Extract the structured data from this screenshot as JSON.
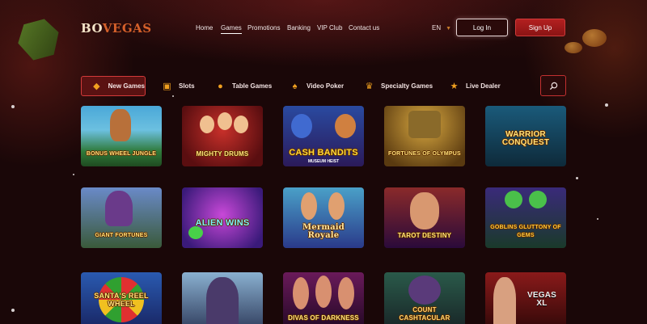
{
  "brand": {
    "logo_part1": "BO",
    "logo_part2": "VEGAS"
  },
  "nav": {
    "items": [
      {
        "label": "Home",
        "active": false
      },
      {
        "label": "Games",
        "active": true
      },
      {
        "label": "Promotions",
        "active": false
      },
      {
        "label": "Banking",
        "active": false
      },
      {
        "label": "VIP Club",
        "active": false
      },
      {
        "label": "Contact us",
        "active": false
      }
    ],
    "language": "EN",
    "login_label": "Log In",
    "signup_label": "Sign Up"
  },
  "categories": [
    {
      "label": "New Games",
      "icon": "diamond-icon",
      "active": true
    },
    {
      "label": "Slots",
      "icon": "slot-machine-icon",
      "active": false
    },
    {
      "label": "Table Games",
      "icon": "chip-icon",
      "active": false
    },
    {
      "label": "Video Poker",
      "icon": "spade-icon",
      "active": false
    },
    {
      "label": "Specialty Games",
      "icon": "crown-icon",
      "active": false
    },
    {
      "label": "Live Dealer",
      "icon": "star-icon",
      "active": false
    }
  ],
  "games": [
    {
      "title": "BONUS WHEEL JUNGLE",
      "subtitle": ""
    },
    {
      "title": "MIGHTY DRUMS",
      "subtitle": ""
    },
    {
      "title": "CASH BANDITS",
      "subtitle": "MUSEUM HEIST"
    },
    {
      "title": "FORTUNES OF OLYMPUS",
      "subtitle": ""
    },
    {
      "title": "WARRIOR CONQUEST",
      "subtitle": ""
    },
    {
      "title": "GIANT FORTUNES",
      "subtitle": ""
    },
    {
      "title": "ALIEN WINS",
      "subtitle": ""
    },
    {
      "title": "Mermaid Royale",
      "subtitle": ""
    },
    {
      "title": "TAROT DESTINY",
      "subtitle": ""
    },
    {
      "title": "GOBLINS GLUTTONY OF GEMS",
      "subtitle": ""
    },
    {
      "title": "SANTA'S REEL WHEEL",
      "subtitle": ""
    },
    {
      "title": "",
      "subtitle": ""
    },
    {
      "title": "DIVAS OF DARKNESS",
      "subtitle": ""
    },
    {
      "title": "COUNT CASHTACULAR",
      "subtitle": ""
    },
    {
      "title": "VEGAS XL",
      "subtitle": ""
    }
  ],
  "colors": {
    "accent_red": "#c23030",
    "gold": "#ffe27a",
    "background": "#1c0708"
  }
}
